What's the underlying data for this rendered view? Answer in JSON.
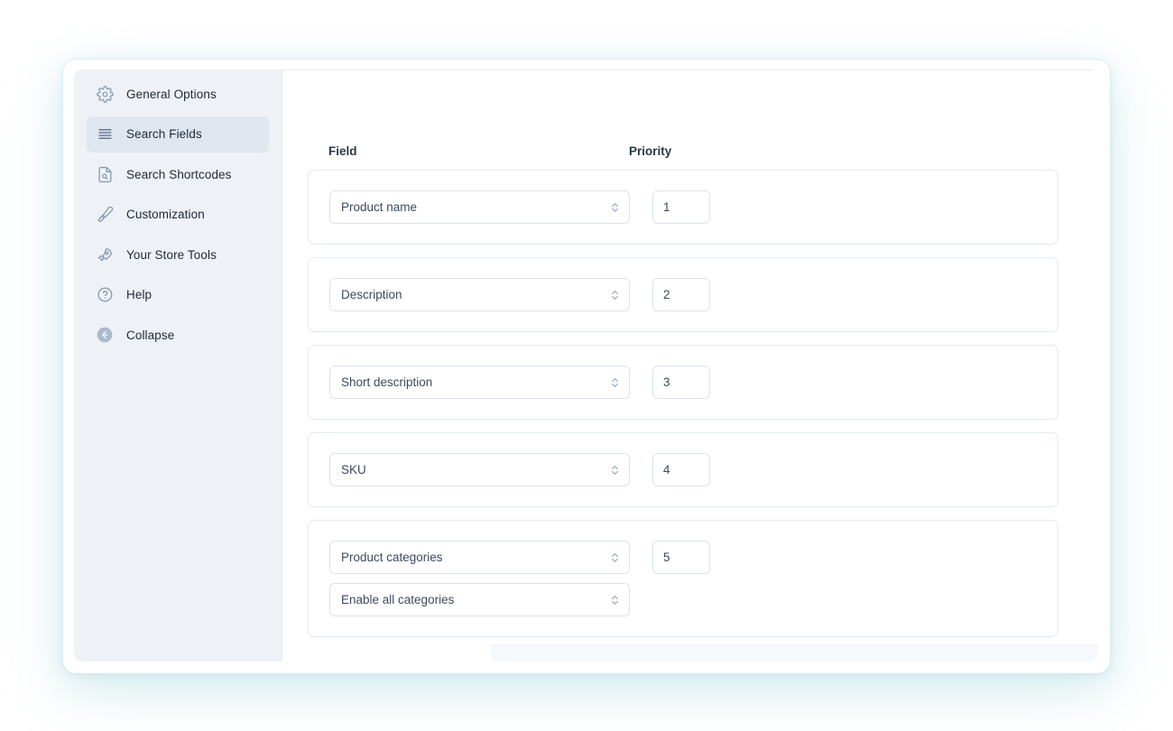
{
  "sidebar": {
    "items": [
      {
        "label": "General Options",
        "icon": "gear-icon",
        "active": false
      },
      {
        "label": "Search Fields",
        "icon": "lines-icon",
        "active": true
      },
      {
        "label": "Search Shortcodes",
        "icon": "document-search-icon",
        "active": false
      },
      {
        "label": "Customization",
        "icon": "eyedropper-icon",
        "active": false
      },
      {
        "label": "Your Store Tools",
        "icon": "rocket-icon",
        "active": false
      },
      {
        "label": "Help",
        "icon": "question-circle-icon",
        "active": false
      },
      {
        "label": "Collapse",
        "icon": "arrow-left-circle-icon",
        "active": false
      }
    ]
  },
  "main": {
    "headers": {
      "field": "Field",
      "priority": "Priority"
    },
    "rows": [
      {
        "field": "Product name",
        "priority": "1"
      },
      {
        "field": "Description",
        "priority": "2"
      },
      {
        "field": "Short description",
        "priority": "3"
      },
      {
        "field": "SKU",
        "priority": "4"
      },
      {
        "field": "Product categories",
        "priority": "5",
        "sub_field": "Enable all categories"
      }
    ]
  },
  "colors": {
    "sidebar_bg": "#eef2f7",
    "sidebar_active_bg": "#dfe6ef",
    "text_primary": "#1f2937",
    "text_field": "#3d4a5c",
    "border": "#dbe3ec",
    "card_border": "#e4eaf1",
    "glow": "#96cdd7"
  }
}
